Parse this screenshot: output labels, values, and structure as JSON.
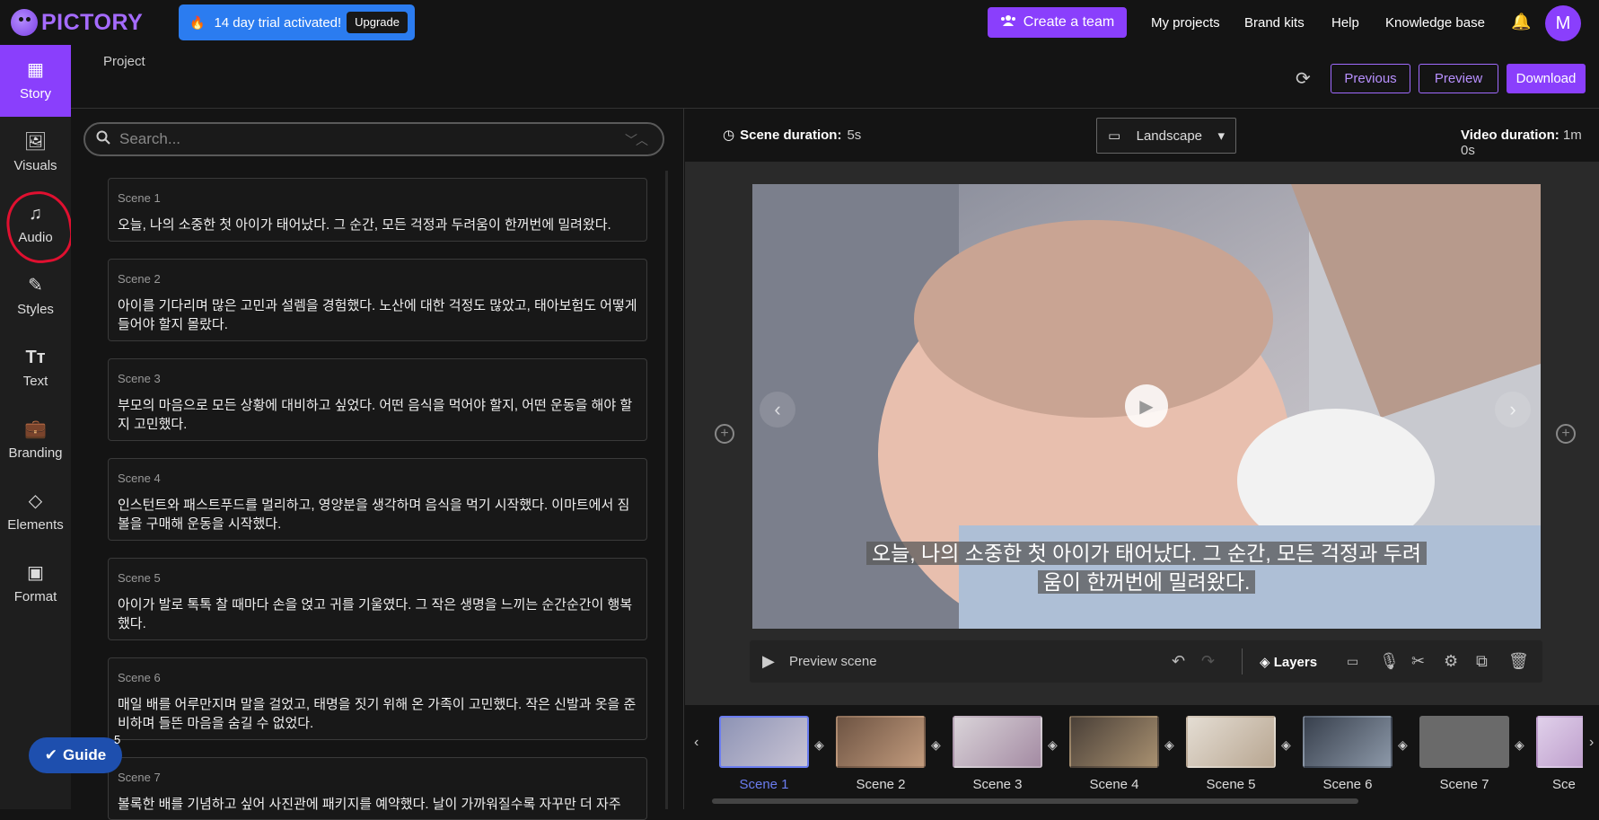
{
  "app": {
    "brand": "PICTORY"
  },
  "topbar": {
    "trial_text": "14 day trial activated!",
    "upgrade_label": "Upgrade",
    "create_team_label": "Create a team",
    "links": [
      "My projects",
      "Brand kits",
      "Help",
      "Knowledge base"
    ],
    "avatar_initial": "M"
  },
  "sidebar": {
    "items": [
      {
        "label": "Story",
        "icon": "story-icon",
        "active": true
      },
      {
        "label": "Visuals",
        "icon": "image-icon"
      },
      {
        "label": "Audio",
        "icon": "music-icon"
      },
      {
        "label": "Styles",
        "icon": "paint-icon"
      },
      {
        "label": "Text",
        "icon": "text-icon"
      },
      {
        "label": "Branding",
        "icon": "briefcase-icon"
      },
      {
        "label": "Elements",
        "icon": "shapes-icon"
      },
      {
        "label": "Format",
        "icon": "format-icon"
      }
    ]
  },
  "header": {
    "breadcrumb": "Project",
    "previous_label": "Previous",
    "preview_label": "Preview",
    "download_label": "Download"
  },
  "search": {
    "placeholder": "Search..."
  },
  "scenes": [
    {
      "label": "Scene 1",
      "text": "오늘, 나의 소중한 첫 아이가 태어났다. 그 순간, 모든 걱정과 두려움이 한꺼번에 밀려왔다."
    },
    {
      "label": "Scene 2",
      "text": "아이를 기다리며 많은 고민과 설렘을 경험했다. 노산에 대한 걱정도 많았고, 태아보험도 어떻게 들어야 할지 몰랐다."
    },
    {
      "label": "Scene 3",
      "text": "부모의 마음으로 모든 상황에 대비하고 싶었다. 어떤 음식을 먹어야 할지, 어떤 운동을 해야 할지 고민했다."
    },
    {
      "label": "Scene 4",
      "text": "인스턴트와 패스트푸드를 멀리하고, 영양분을 생각하며 음식을 먹기 시작했다. 이마트에서 짐볼을 구매해 운동을 시작했다."
    },
    {
      "label": "Scene 5",
      "text": "아이가 발로 톡톡 찰 때마다 손을 얹고 귀를 기울였다. 그 작은 생명을 느끼는 순간순간이 행복했다."
    },
    {
      "label": "Scene 6",
      "text": "매일 배를 어루만지며 말을 걸었고, 태명을 짓기 위해 온 가족이 고민했다. 작은 신발과 옷을 준비하며 들뜬 마음을 숨길 수 없었다."
    },
    {
      "label": "Scene 7",
      "text": "볼록한 배를 기념하고 싶어 사진관에 패키지를 예약했다. 날이 가까워질수록 자꾸만 더 자주"
    }
  ],
  "editor": {
    "scene_duration_label": "Scene duration:",
    "scene_duration_value": "5s",
    "orientation": "Landscape",
    "video_duration_label": "Video duration:",
    "video_duration_value": "1m 0s",
    "caption_line1": "오늘, 나의 소중한 첫 아이가 태어났다. 그 순간, 모든 걱정과 두려",
    "caption_line2": "움이 한꺼번에 밀려왔다.",
    "preview_scene_label": "Preview scene",
    "layers_label": "Layers"
  },
  "timeline": {
    "thumbs": [
      {
        "label": "Scene 1",
        "active": true
      },
      {
        "label": "Scene 2"
      },
      {
        "label": "Scene 3"
      },
      {
        "label": "Scene 4"
      },
      {
        "label": "Scene 5"
      },
      {
        "label": "Scene 6"
      },
      {
        "label": "Scene 7"
      },
      {
        "label": "Sce"
      }
    ]
  },
  "guide": {
    "label": "Guide",
    "badge": "5"
  },
  "colors": {
    "accent": "#8a3ffc",
    "trial": "#2b7cf0",
    "active_scene": "#6b7df0",
    "annotation": "#e01030"
  }
}
